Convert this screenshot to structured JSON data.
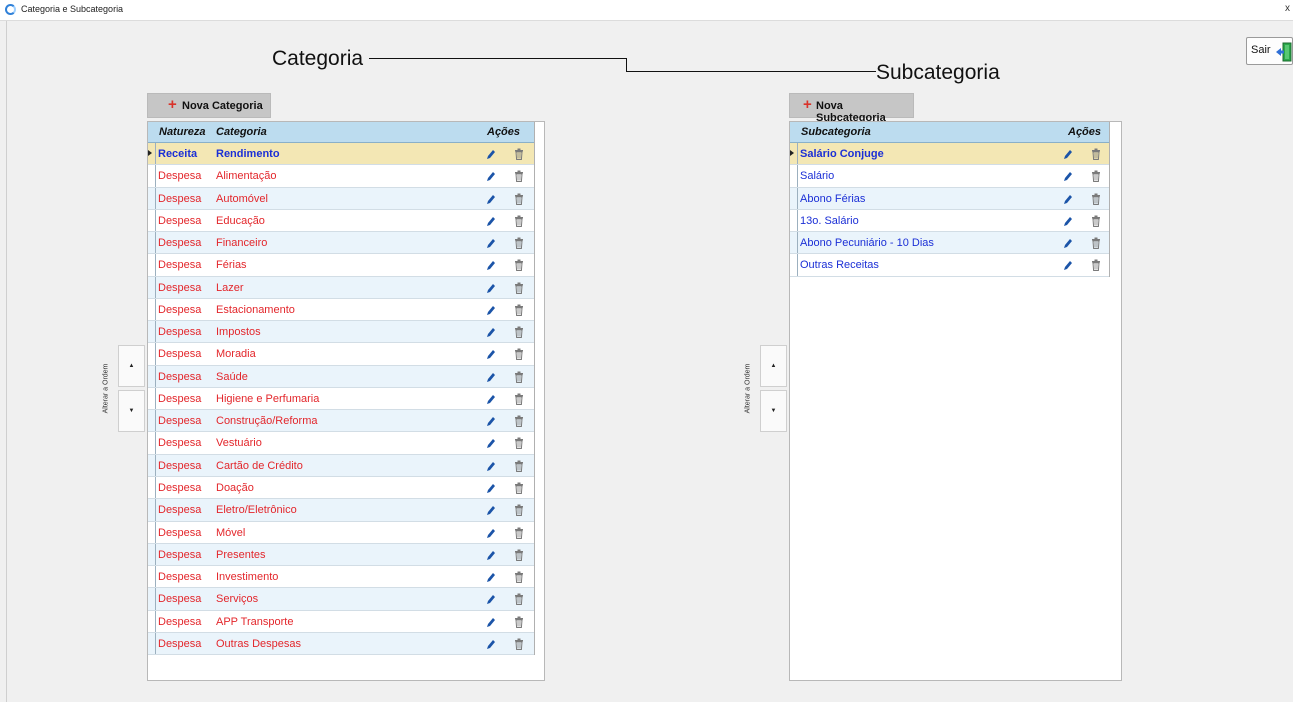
{
  "window": {
    "title": "Categoria e Subcategoria",
    "close_glyph": "x",
    "app_icon": "app-icon"
  },
  "header": {
    "category_label": "Categoria",
    "subcategory_label": "Subcategoria"
  },
  "exit": {
    "label": "Sair",
    "icon": "exit-door-icon",
    "icon_color": "#2aa84a"
  },
  "categories": {
    "new_button": "Nova Categoria",
    "order_label": "Alterar a Ordem",
    "up": "▲",
    "down": "▼",
    "columns": {
      "natureza": "Natureza",
      "categoria": "Categoria",
      "acoes": "Ações"
    },
    "rows": [
      {
        "natureza": "Receita",
        "categoria": "Rendimento"
      },
      {
        "natureza": "Despesa",
        "categoria": "Alimentação"
      },
      {
        "natureza": "Despesa",
        "categoria": "Automóvel"
      },
      {
        "natureza": "Despesa",
        "categoria": "Educação"
      },
      {
        "natureza": "Despesa",
        "categoria": "Financeiro"
      },
      {
        "natureza": "Despesa",
        "categoria": "Férias"
      },
      {
        "natureza": "Despesa",
        "categoria": "Lazer"
      },
      {
        "natureza": "Despesa",
        "categoria": "Estacionamento"
      },
      {
        "natureza": "Despesa",
        "categoria": "Impostos"
      },
      {
        "natureza": "Despesa",
        "categoria": "Moradia"
      },
      {
        "natureza": "Despesa",
        "categoria": "Saúde"
      },
      {
        "natureza": "Despesa",
        "categoria": "Higiene e Perfumaria"
      },
      {
        "natureza": "Despesa",
        "categoria": "Construção/Reforma"
      },
      {
        "natureza": "Despesa",
        "categoria": "Vestuário"
      },
      {
        "natureza": "Despesa",
        "categoria": "Cartão de Crédito"
      },
      {
        "natureza": "Despesa",
        "categoria": "Doação"
      },
      {
        "natureza": "Despesa",
        "categoria": "Eletro/Eletrônico"
      },
      {
        "natureza": "Despesa",
        "categoria": "Móvel"
      },
      {
        "natureza": "Despesa",
        "categoria": "Presentes"
      },
      {
        "natureza": "Despesa",
        "categoria": "Investimento"
      },
      {
        "natureza": "Despesa",
        "categoria": "Serviços"
      },
      {
        "natureza": "Despesa",
        "categoria": "APP Transporte"
      },
      {
        "natureza": "Despesa",
        "categoria": "Outras Despesas"
      }
    ]
  },
  "subcategories": {
    "new_button": "Nova Subcategoria",
    "order_label": "Alterar a Ordem",
    "up": "▲",
    "down": "▼",
    "columns": {
      "subcategoria": "Subcategoria",
      "acoes": "Ações"
    },
    "rows": [
      {
        "subcategoria": "Salário Conjuge"
      },
      {
        "subcategoria": "Salário"
      },
      {
        "subcategoria": "Abono Férias"
      },
      {
        "subcategoria": "13o. Salário"
      },
      {
        "subcategoria": "Abono Pecuniário - 10 Dias"
      },
      {
        "subcategoria": "Outras Receitas"
      }
    ]
  },
  "colors": {
    "receita": "#1b2fd6",
    "despesa": "#e3262b",
    "selected_row": "#f3e7b4",
    "header_bg": "#bcdcef",
    "edit_icon": "#1b54a8",
    "delete_icon": "#7a7a7a"
  },
  "icons": {
    "edit": "pencil-icon",
    "delete": "trash-icon",
    "add": "plus-icon"
  }
}
